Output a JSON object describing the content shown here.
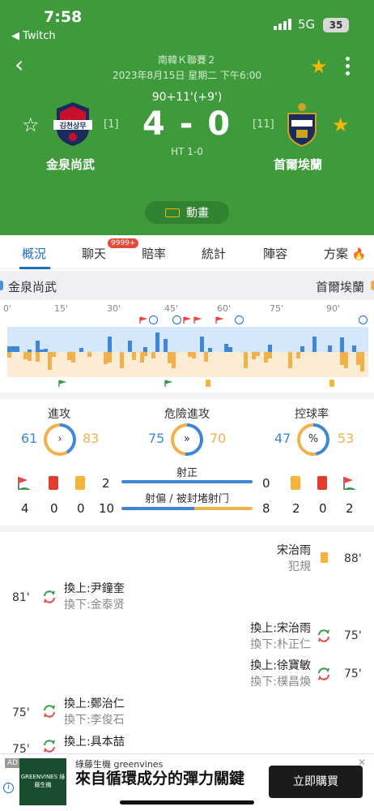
{
  "status_bar": {
    "time": "7:58",
    "back_app": "◀ Twitch",
    "network": "5G",
    "battery": "35"
  },
  "header": {
    "league": "南韓Ｋ聯賽２",
    "datetime": "2023年8月15日 星期二 下午6:00",
    "match_time": "90+11'(+9')",
    "score": "4 - 0",
    "half_time": "HT 1-0",
    "home": {
      "name": "金泉尚武",
      "rank": "[1]",
      "logo_text": "김천상무"
    },
    "away": {
      "name": "首爾埃蘭",
      "rank": "[11]"
    },
    "animation_label": "動畫"
  },
  "tabs": [
    {
      "label": "概況"
    },
    {
      "label": "聊天"
    },
    {
      "label": "賠率"
    },
    {
      "label": "統計"
    },
    {
      "label": "陣容"
    },
    {
      "label": "方案"
    }
  ],
  "chat_badge": "9999+",
  "timeline": {
    "home_team": "金泉尚武",
    "away_team": "首爾埃蘭",
    "minute_labels": [
      "0'",
      "15'",
      "30'",
      "45'",
      "60'",
      "75'",
      "90'"
    ],
    "home_pressure": [
      7,
      7,
      7,
      0,
      0,
      3,
      0,
      14,
      3,
      4,
      0,
      0,
      0,
      0,
      0,
      0,
      0,
      0,
      5,
      0,
      0,
      0,
      0,
      0,
      0,
      19,
      0,
      0,
      0,
      0,
      14,
      0,
      0,
      0,
      6,
      0,
      0,
      24,
      0,
      16,
      0,
      0,
      0,
      0,
      0,
      0,
      0,
      0,
      19,
      0,
      5,
      0,
      0,
      0,
      10,
      6,
      0,
      0,
      0,
      0,
      0,
      0,
      0,
      0,
      0,
      9,
      0,
      0,
      0,
      0,
      0,
      0,
      0,
      7,
      0,
      0,
      19,
      0,
      0,
      0,
      8,
      0,
      0,
      18,
      0,
      0,
      8,
      0,
      0,
      0
    ],
    "away_pressure": [
      7,
      0,
      0,
      0,
      9,
      11,
      0,
      12,
      0,
      0,
      22,
      6,
      0,
      0,
      0,
      10,
      13,
      0,
      0,
      0,
      6,
      0,
      0,
      0,
      15,
      13,
      0,
      0,
      20,
      0,
      0,
      10,
      0,
      13,
      5,
      0,
      8,
      0,
      0,
      0,
      14,
      20,
      0,
      0,
      0,
      6,
      8,
      0,
      0,
      12,
      0,
      0,
      0,
      0,
      0,
      0,
      0,
      0,
      0,
      20,
      0,
      9,
      5,
      0,
      13,
      8,
      0,
      0,
      0,
      0,
      20,
      0,
      8,
      0,
      0,
      0,
      0,
      0,
      0,
      0,
      0,
      0,
      0,
      16,
      20,
      0,
      0,
      16,
      24,
      0
    ],
    "colors": {
      "home": "#3d86d8",
      "away": "#f0b04c"
    }
  },
  "stats": {
    "attacks": {
      "label": "進攻",
      "home": "61",
      "away": "83",
      "home_ratio": 0.42
    },
    "dangerous": {
      "label": "危險進攻",
      "home": "75",
      "away": "70",
      "home_ratio": 0.52
    },
    "possession": {
      "label": "控球率",
      "home": "47",
      "away": "53",
      "home_ratio": 0.47
    },
    "home_row1": {
      "yellow": "2"
    },
    "home_row2": {
      "corners": "4",
      "red": "0",
      "yellow": "0",
      "shots_off": "10"
    },
    "away_row1": {
      "shots_on": "0"
    },
    "away_row2": {
      "shots_off": "8",
      "yellow": "2",
      "red": "0",
      "corners": "2"
    },
    "shots_on_label": "射正",
    "shots_off_label": "射偏 / 被封堵射门",
    "shots_on_ratio": 1.0,
    "shots_off_ratio": 0.556
  },
  "events": [
    {
      "side": "away",
      "player": "宋治雨",
      "detail": "犯規",
      "minute": "88'"
    },
    {
      "side": "home",
      "in": "換上:尹鐘奎",
      "out": "換下:金泰贤",
      "minute": "81'"
    },
    {
      "side": "away",
      "in": "換上:宋治雨",
      "out": "換下:朴正仁",
      "minute": "75'"
    },
    {
      "side": "away",
      "in": "換上:徐寶敏",
      "out": "換下:樸昌煥",
      "minute": "75'"
    },
    {
      "side": "home",
      "in": "換上:鄭治仁",
      "out": "換下:李俊石",
      "minute": "75'"
    },
    {
      "side": "home",
      "in": "換上:具本喆",
      "out": "",
      "minute": "75'"
    }
  ],
  "ad": {
    "tag": "AD",
    "logo_text": "GREENVINES 綠藤生機",
    "brand": "綠藤生機 greenvines",
    "headline": "來自循環成分的彈力關鍵",
    "cta": "立即購買"
  }
}
